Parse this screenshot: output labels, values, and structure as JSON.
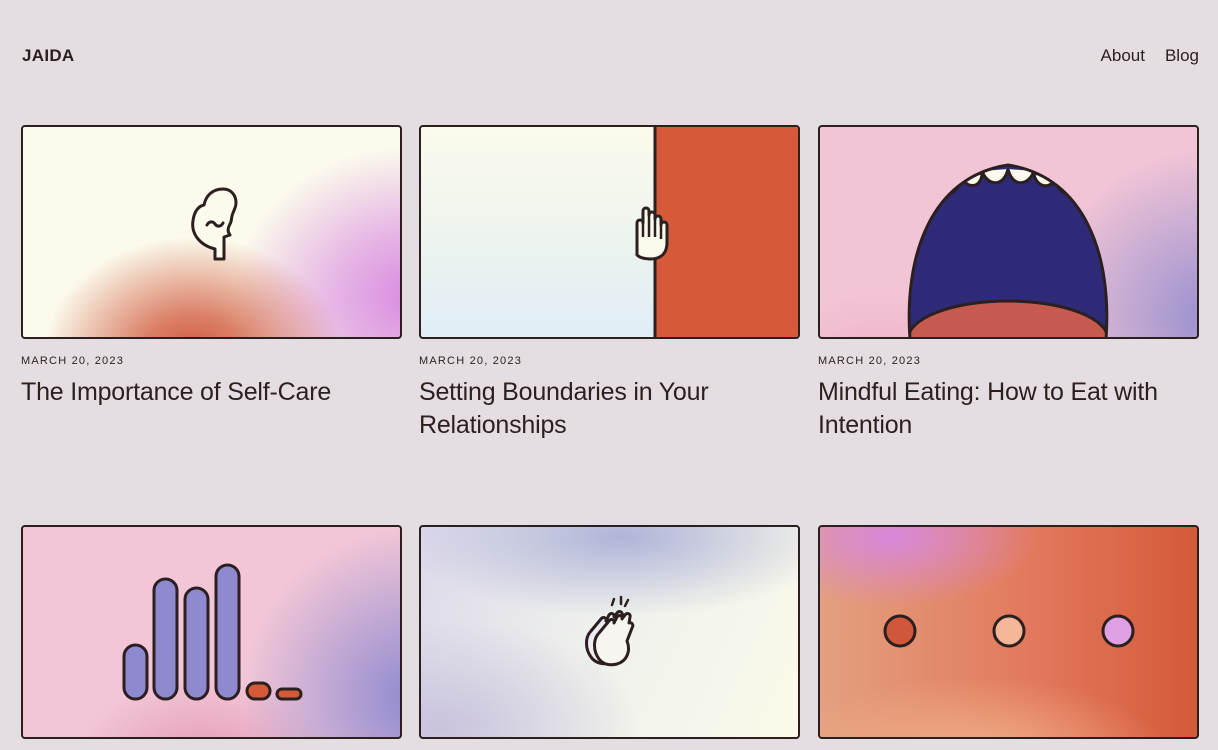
{
  "header": {
    "logo": "JAIDA",
    "nav": [
      {
        "label": "About"
      },
      {
        "label": "Blog"
      }
    ]
  },
  "posts": [
    {
      "date": "MARCH 20, 2023",
      "title": "The Importance of Self-Care",
      "icon": "head-icon"
    },
    {
      "date": "MARCH 20, 2023",
      "title": "Setting Boundaries in Your Relationships",
      "icon": "raised-hand-icon"
    },
    {
      "date": "MARCH 20, 2023",
      "title": "Mindful Eating: How to Eat with Intention",
      "icon": "open-mouth-icon"
    },
    {
      "icon": "bar-chart-icon"
    },
    {
      "icon": "clapping-hands-icon"
    },
    {
      "icon": "three-dots-icon"
    }
  ],
  "colors": {
    "background": "#e4dde2",
    "ink": "#2b1f1f",
    "orange": "#d45a39",
    "purple": "#9890d0",
    "navy": "#2e2a78"
  }
}
